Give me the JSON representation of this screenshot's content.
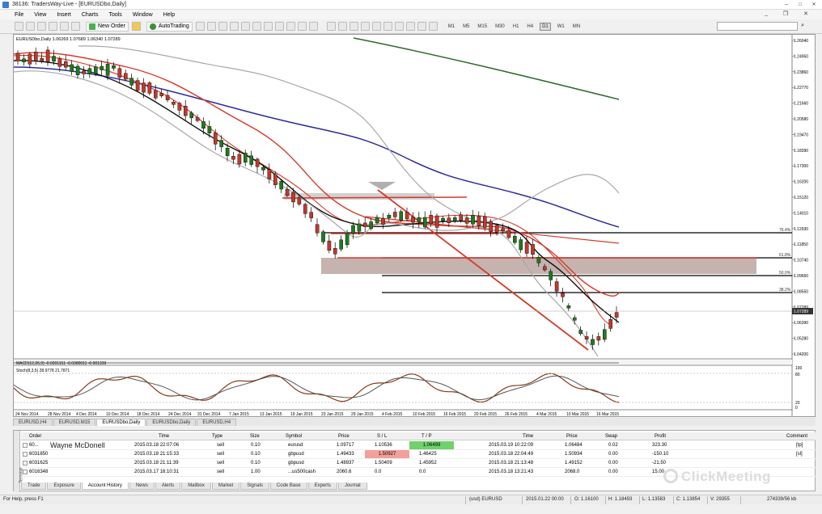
{
  "window": {
    "title": "38136: TradersWay-Live - [EURUSDbo,Daily]"
  },
  "menu": [
    "File",
    "View",
    "Insert",
    "Charts",
    "Tools",
    "Window",
    "Help"
  ],
  "toolbar": {
    "new_order": "New Order",
    "autotrading": "AutoTrading",
    "timeframes": [
      "M1",
      "M5",
      "M15",
      "M30",
      "H1",
      "H4",
      "D1",
      "W1",
      "MN"
    ],
    "active_timeframe": "D1"
  },
  "chart": {
    "header": "EURUSDbo,Daily  1.06269 1.07689 1.06340 1.07289",
    "macd_label": "MACD(12,26,9) -0.0201151 -0.0380011 -0.001339",
    "stoch_label": "Stoch(8,3,5) 28.9778 21.7871",
    "price_ticks": [
      "1.26040",
      "1.24950",
      "1.23860",
      "1.22770",
      "1.21660",
      "1.20580",
      "1.19470",
      "1.18390",
      "1.17300",
      "1.16200",
      "1.15120",
      "1.14010",
      "1.12930",
      "1.11850",
      "1.10740",
      "1.09660",
      "1.08550",
      "1.07289",
      "1.06390",
      "1.05280",
      "1.04200"
    ],
    "current_price": "1.07289",
    "fib_labels": [
      "76.4%",
      "61.8%",
      "50.0%",
      "38.2%"
    ],
    "stoch_ticks": [
      "100",
      "80",
      "20",
      "0"
    ],
    "date_ticks": [
      "24 Nov 2014",
      "28 Nov 2014",
      "4 Dec 2014",
      "10 Dec 2014",
      "18 Dec 2014",
      "24 Dec 2014",
      "31 Dec 2014",
      "7 Jan 2015",
      "13 Jan 2015",
      "19 Jan 2015",
      "23 Jan 2015",
      "29 Jan 2015",
      "4 Feb 2015",
      "10 Feb 2015",
      "16 Feb 2015",
      "20 Feb 2015",
      "26 Feb 2015",
      "4 Mar 2015",
      "10 Mar 2015",
      "16 Mar 2015"
    ]
  },
  "chart_tabs": [
    "EURUSD,H4",
    "EURUSD,M15",
    "EURUSDbo,Daily",
    "EURUSDbo,Daily",
    "EURUSD,H4"
  ],
  "active_chart_tab": 2,
  "terminal": {
    "side_label": "Terminal",
    "columns": [
      "Order",
      "Time",
      "Type",
      "Size",
      "Symbol",
      "Price",
      "S / L",
      "T / P",
      "Time",
      "Price",
      "Swap",
      "Profit",
      "Comment"
    ],
    "rows": [
      [
        "60...",
        "2015.03.18 22:07:06",
        "sell",
        "0.10",
        "eurusd",
        "1.09717",
        "1.10536",
        "1.06499",
        "2015.03.19 10:22:09",
        "1.06484",
        "0.02",
        "323.30",
        "[tp]"
      ],
      [
        "6031850",
        "2015.03.18 21:15:33",
        "sell",
        "0.10",
        "gbpusd",
        "1.49433",
        "1.50927",
        "1.46425",
        "2015.03.18 22:04:49",
        "1.50934",
        "0.00",
        "-150.10",
        "[sl]"
      ],
      [
        "6031625",
        "2015.03.18 21:11:39",
        "sell",
        "0.10",
        "gbpusd",
        "1.48937",
        "1.50409",
        "1.45952",
        "2015.03.18 21:13:48",
        "1.49152",
        "0.00",
        "-21.50",
        ""
      ],
      [
        "6016348",
        "2015.03.17 16:10:31",
        "sell",
        "1.00",
        "...us500cash",
        "2060.6",
        "0.0",
        "0.0",
        "2015.03.18 13:21:43",
        "2068.0",
        "0.00",
        "15.00",
        ""
      ]
    ],
    "tabs": [
      "Trade",
      "Exposure",
      "Account History",
      "News",
      "Alerts",
      "Mailbox",
      "Market",
      "Signals",
      "Code Base",
      "Experts",
      "Journal"
    ],
    "active_tab": "Account History",
    "presenter": "Wayne McDonell"
  },
  "status": {
    "help": "For Help, press F1",
    "profile": "(usd) EURUSD",
    "time": "2015.01.22 00:00",
    "open": "O: 1.16100",
    "high": "H: 1.18493",
    "low": "L: 1.13583",
    "close": "C: 1.13854",
    "volume": "V: 29355",
    "traffic": "274339/56 kb"
  },
  "watermark": "ClickMeeting",
  "colors": {
    "bull": "#1e7a1e",
    "bear": "#c0392b",
    "ma_red": "#d43a2a",
    "ma_black": "#111111",
    "ma_blue": "#2c2c9c",
    "ma_green": "#2e6b2e",
    "ma_gray": "#a8a8a8"
  }
}
